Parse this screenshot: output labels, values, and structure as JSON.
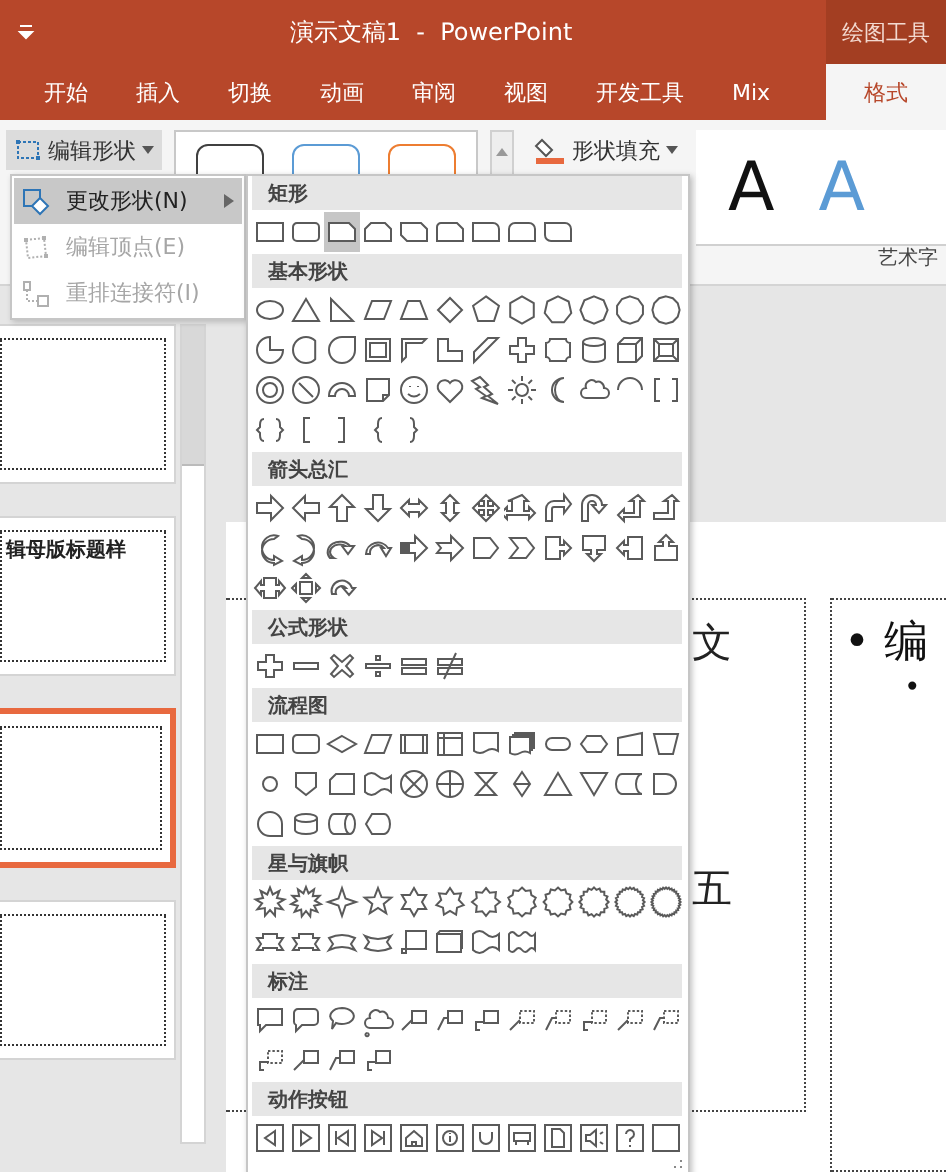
{
  "window": {
    "title": "演示文稿1  -  PowerPoint",
    "context_tab": "绘图工具"
  },
  "tabs": [
    {
      "label": "开始",
      "selected": false
    },
    {
      "label": "插入",
      "selected": false
    },
    {
      "label": "切换",
      "selected": false
    },
    {
      "label": "动画",
      "selected": false
    },
    {
      "label": "审阅",
      "selected": false
    },
    {
      "label": "视图",
      "selected": false
    },
    {
      "label": "开发工具",
      "selected": false
    },
    {
      "label": "Mix",
      "selected": false
    },
    {
      "label": "格式",
      "selected": true
    }
  ],
  "ribbon": {
    "edit_shape_button": "编辑形状",
    "shape_styles": [
      {
        "color": "#404040"
      },
      {
        "color": "#5b9bd5"
      },
      {
        "color": "#ed7d31"
      }
    ],
    "shape_fill_button": "形状填充",
    "wordart_samples": [
      {
        "text": "A",
        "color": "#111111"
      },
      {
        "text": "A",
        "color": "#5b9bd5"
      }
    ],
    "group_label": "艺术字"
  },
  "edit_shape_menu": {
    "items": [
      {
        "label": "更改形状(N)",
        "selected": true,
        "disabled": false,
        "submenu": true,
        "kind": "change"
      },
      {
        "label": "编辑顶点(E)",
        "selected": false,
        "disabled": true,
        "submenu": false,
        "kind": "points"
      },
      {
        "label": "重排连接符(I)",
        "selected": false,
        "disabled": true,
        "submenu": false,
        "kind": "reroute"
      }
    ]
  },
  "shape_gallery": {
    "sections": [
      {
        "title": "矩形",
        "shapes": [
          {
            "kind": "rect",
            "selected": false
          },
          {
            "kind": "roundrect",
            "selected": false
          },
          {
            "kind": "snip",
            "selected": true
          },
          {
            "kind": "snip2",
            "selected": false
          },
          {
            "kind": "snipdiag",
            "selected": false
          },
          {
            "kind": "snipround",
            "selected": false
          },
          {
            "kind": "round1",
            "selected": false
          },
          {
            "kind": "round2",
            "selected": false
          },
          {
            "kind": "rounddiag",
            "selected": false
          }
        ]
      },
      {
        "title": "基本形状",
        "shapes": [
          {
            "kind": "ellipse",
            "selected": false
          },
          {
            "kind": "triangle",
            "selected": false
          },
          {
            "kind": "rtriangle",
            "selected": false
          },
          {
            "kind": "parallelogram",
            "selected": false
          },
          {
            "kind": "trapezoid",
            "selected": false
          },
          {
            "kind": "diamond",
            "selected": false
          },
          {
            "kind": "pentagon",
            "selected": false
          },
          {
            "kind": "hexagon",
            "selected": false
          },
          {
            "kind": "heptagon",
            "selected": false
          },
          {
            "kind": "octagon",
            "selected": false
          },
          {
            "kind": "decagon",
            "selected": false
          },
          {
            "kind": "dodecagon",
            "selected": false
          },
          {
            "kind": "pie",
            "selected": false
          },
          {
            "kind": "chord",
            "selected": false
          },
          {
            "kind": "teardrop",
            "selected": false
          },
          {
            "kind": "frame",
            "selected": false
          },
          {
            "kind": "halfframe",
            "selected": false
          },
          {
            "kind": "lshape",
            "selected": false
          },
          {
            "kind": "diagstripe",
            "selected": false
          },
          {
            "kind": "plus",
            "selected": false
          },
          {
            "kind": "plaque",
            "selected": false
          },
          {
            "kind": "can",
            "selected": false
          },
          {
            "kind": "cube",
            "selected": false
          },
          {
            "kind": "bevel",
            "selected": false
          },
          {
            "kind": "donut",
            "selected": false
          },
          {
            "kind": "nosymbol",
            "selected": false
          },
          {
            "kind": "blockarc",
            "selected": false
          },
          {
            "kind": "folded",
            "selected": false
          },
          {
            "kind": "smiley",
            "selected": false
          },
          {
            "kind": "heart",
            "selected": false
          },
          {
            "kind": "lightning",
            "selected": false
          },
          {
            "kind": "sun",
            "selected": false
          },
          {
            "kind": "moon",
            "selected": false
          },
          {
            "kind": "cloud",
            "selected": false
          },
          {
            "kind": "arc",
            "selected": false
          },
          {
            "kind": "bracketpair",
            "selected": false
          },
          {
            "kind": "bracepair",
            "selected": false
          },
          {
            "kind": "lbracket",
            "selected": false
          },
          {
            "kind": "rbracket",
            "selected": false
          },
          {
            "kind": "lbrace",
            "selected": false
          },
          {
            "kind": "rbrace",
            "selected": false
          }
        ]
      },
      {
        "title": "箭头总汇",
        "shapes": [
          {
            "kind": "arrow-right",
            "selected": false
          },
          {
            "kind": "arrow-left",
            "selected": false
          },
          {
            "kind": "arrow-up",
            "selected": false
          },
          {
            "kind": "arrow-down",
            "selected": false
          },
          {
            "kind": "arrow-leftright",
            "selected": false
          },
          {
            "kind": "arrow-updown",
            "selected": false
          },
          {
            "kind": "arrow-quad",
            "selected": false
          },
          {
            "kind": "arrow-leftrightup",
            "selected": false
          },
          {
            "kind": "arrow-bent",
            "selected": false
          },
          {
            "kind": "arrow-uturn",
            "selected": false
          },
          {
            "kind": "arrow-leftup",
            "selected": false
          },
          {
            "kind": "arrow-bentup",
            "selected": false
          },
          {
            "kind": "arrow-curvedright",
            "selected": false
          },
          {
            "kind": "arrow-curvedleft",
            "selected": false
          },
          {
            "kind": "arrow-curvedup",
            "selected": false
          },
          {
            "kind": "arrow-curveddown",
            "selected": false
          },
          {
            "kind": "arrow-striped",
            "selected": false
          },
          {
            "kind": "arrow-notched",
            "selected": false
          },
          {
            "kind": "homeplate",
            "selected": false
          },
          {
            "kind": "chevron",
            "selected": false
          },
          {
            "kind": "callout-arrow-right",
            "selected": false
          },
          {
            "kind": "callout-arrow-down",
            "selected": false
          },
          {
            "kind": "callout-arrow-left",
            "selected": false
          },
          {
            "kind": "callout-arrow-up",
            "selected": false
          },
          {
            "kind": "callout-arrow-leftright",
            "selected": false
          },
          {
            "kind": "callout-arrow-quad",
            "selected": false
          },
          {
            "kind": "arrow-circular",
            "selected": false
          }
        ]
      },
      {
        "title": "公式形状",
        "shapes": [
          {
            "kind": "math-plus",
            "selected": false
          },
          {
            "kind": "math-minus",
            "selected": false
          },
          {
            "kind": "math-multiply",
            "selected": false
          },
          {
            "kind": "math-divide",
            "selected": false
          },
          {
            "kind": "math-equal",
            "selected": false
          },
          {
            "kind": "math-notequal",
            "selected": false
          }
        ]
      },
      {
        "title": "流程图",
        "shapes": [
          {
            "kind": "process",
            "selected": false
          },
          {
            "kind": "alternate",
            "selected": false
          },
          {
            "kind": "decision",
            "selected": false
          },
          {
            "kind": "data",
            "selected": false
          },
          {
            "kind": "predefined",
            "selected": false
          },
          {
            "kind": "internal",
            "selected": false
          },
          {
            "kind": "document",
            "selected": false
          },
          {
            "kind": "multidoc",
            "selected": false
          },
          {
            "kind": "terminator",
            "selected": false
          },
          {
            "kind": "preparation",
            "selected": false
          },
          {
            "kind": "manualinput",
            "selected": false
          },
          {
            "kind": "manualop",
            "selected": false
          },
          {
            "kind": "connector",
            "selected": false
          },
          {
            "kind": "offpage",
            "selected": false
          },
          {
            "kind": "card",
            "selected": false
          },
          {
            "kind": "punchedtape",
            "selected": false
          },
          {
            "kind": "summing",
            "selected": false
          },
          {
            "kind": "or",
            "selected": false
          },
          {
            "kind": "collate",
            "selected": false
          },
          {
            "kind": "sort",
            "selected": false
          },
          {
            "kind": "extract",
            "selected": false
          },
          {
            "kind": "merge",
            "selected": false
          },
          {
            "kind": "storeddata",
            "selected": false
          },
          {
            "kind": "delay",
            "selected": false
          },
          {
            "kind": "seqaccess",
            "selected": false
          },
          {
            "kind": "magdisk",
            "selected": false
          },
          {
            "kind": "directaccess",
            "selected": false
          },
          {
            "kind": "display",
            "selected": false
          }
        ]
      },
      {
        "title": "星与旗帜",
        "shapes": [
          {
            "kind": "explosion1",
            "selected": false
          },
          {
            "kind": "explosion2",
            "selected": false
          },
          {
            "kind": "star4",
            "selected": false
          },
          {
            "kind": "star5",
            "selected": false
          },
          {
            "kind": "star6",
            "selected": false
          },
          {
            "kind": "star7",
            "selected": false
          },
          {
            "kind": "star8",
            "selected": false
          },
          {
            "kind": "star10",
            "selected": false
          },
          {
            "kind": "star12",
            "selected": false
          },
          {
            "kind": "star16",
            "selected": false
          },
          {
            "kind": "star24",
            "selected": false
          },
          {
            "kind": "star32",
            "selected": false
          },
          {
            "kind": "ribbon-up",
            "selected": false
          },
          {
            "kind": "ribbon-down",
            "selected": false
          },
          {
            "kind": "ribbon-curvedup",
            "selected": false
          },
          {
            "kind": "ribbon-curveddown",
            "selected": false
          },
          {
            "kind": "vscroll",
            "selected": false
          },
          {
            "kind": "hscroll",
            "selected": false
          },
          {
            "kind": "wave",
            "selected": false
          },
          {
            "kind": "doublewave",
            "selected": false
          }
        ]
      },
      {
        "title": "标注",
        "shapes": [
          {
            "kind": "callout-rect",
            "selected": false
          },
          {
            "kind": "callout-round",
            "selected": false
          },
          {
            "kind": "callout-oval",
            "selected": false
          },
          {
            "kind": "callout-cloud",
            "selected": false
          },
          {
            "kind": "line-callout",
            "selected": false
          },
          {
            "kind": "line-callout-bent",
            "selected": false
          },
          {
            "kind": "line-callout-hook",
            "selected": false
          },
          {
            "kind": "dash-callout",
            "selected": false
          },
          {
            "kind": "dash-callout-bent",
            "selected": false
          },
          {
            "kind": "dash-callout-hook",
            "selected": false
          },
          {
            "kind": "dash-callout",
            "selected": false
          },
          {
            "kind": "dash-callout-bent",
            "selected": false
          },
          {
            "kind": "dash-callout-hook",
            "selected": false
          },
          {
            "kind": "line-callout",
            "selected": false
          },
          {
            "kind": "line-callout-bent",
            "selected": false
          },
          {
            "kind": "line-callout-hook",
            "selected": false
          }
        ]
      },
      {
        "title": "动作按钮",
        "shapes": [
          {
            "kind": "action-back",
            "selected": false
          },
          {
            "kind": "action-forward",
            "selected": false
          },
          {
            "kind": "action-begin",
            "selected": false
          },
          {
            "kind": "action-end",
            "selected": false
          },
          {
            "kind": "action-home",
            "selected": false
          },
          {
            "kind": "action-info",
            "selected": false
          },
          {
            "kind": "action-return",
            "selected": false
          },
          {
            "kind": "action-movie",
            "selected": false
          },
          {
            "kind": "action-document",
            "selected": false
          },
          {
            "kind": "action-sound",
            "selected": false
          },
          {
            "kind": "action-help",
            "selected": false
          },
          {
            "kind": "action-blank",
            "selected": false
          }
        ]
      }
    ]
  },
  "thumbnails": [
    {
      "selected": false
    },
    {
      "selected": false,
      "title": "辑母版标题样"
    },
    {
      "selected": true
    },
    {
      "selected": false
    }
  ],
  "slide": {
    "left_fragments": [
      "文",
      "五"
    ],
    "bullets": [
      {
        "kind": "main",
        "mark": "•",
        "text": "编"
      },
      {
        "kind": "sub",
        "mark": "•"
      }
    ]
  }
}
